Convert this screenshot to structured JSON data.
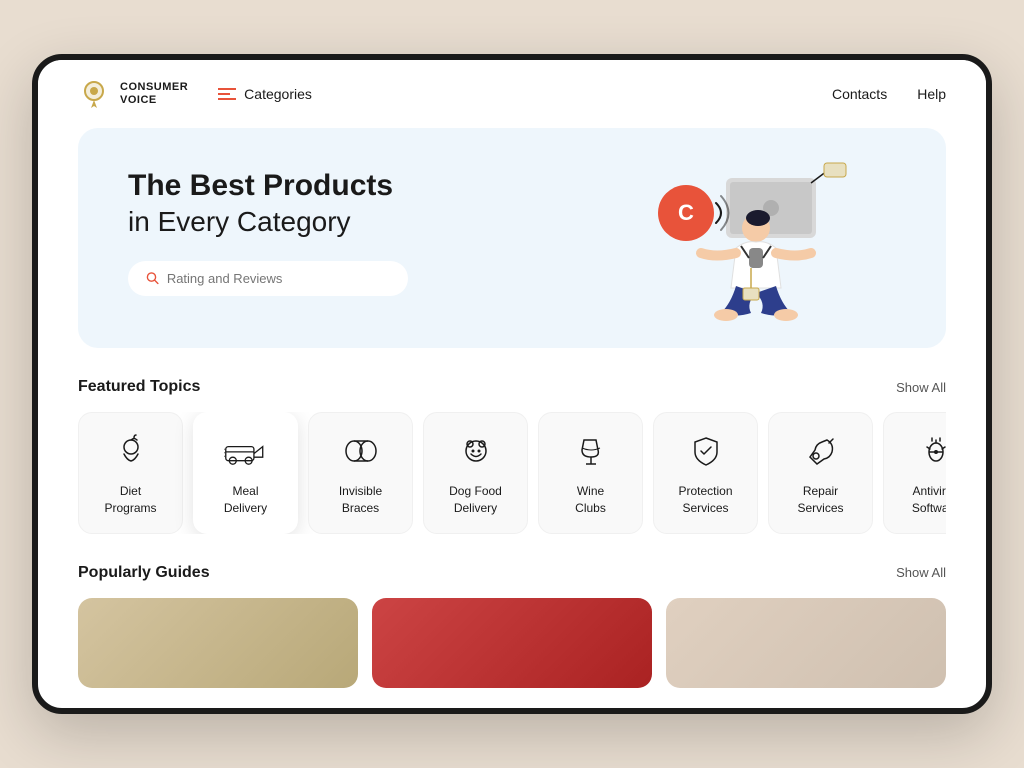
{
  "brand": {
    "logo_text_line1": "CONSUMER",
    "logo_text_line2": "VOICE"
  },
  "header": {
    "categories_label": "Categories",
    "contacts_label": "Contacts",
    "help_label": "Help"
  },
  "hero": {
    "title_bold": "The Best Products",
    "title_light": "in Every Category",
    "search_placeholder": "Rating and Reviews"
  },
  "featured": {
    "section_title": "Featured Topics",
    "show_all_label": "Show All",
    "topics": [
      {
        "id": "diet",
        "label": "Diet\nPrograms",
        "icon": "apple"
      },
      {
        "id": "meal",
        "label": "Meal\nDelivery",
        "icon": "truck",
        "active": true
      },
      {
        "id": "braces",
        "label": "Invisible\nBraces",
        "icon": "glasses"
      },
      {
        "id": "dogfood",
        "label": "Dog Food\nDelivery",
        "icon": "dog"
      },
      {
        "id": "wine",
        "label": "Wine\nClubs",
        "icon": "wine"
      },
      {
        "id": "protection",
        "label": "Protection\nServices",
        "icon": "shield"
      },
      {
        "id": "repair",
        "label": "Repair\nServices",
        "icon": "tools"
      },
      {
        "id": "antivirus",
        "label": "Antivirus\nSoftware",
        "icon": "bug"
      }
    ]
  },
  "guides": {
    "section_title": "Popularly Guides",
    "show_all_label": "Show All"
  }
}
